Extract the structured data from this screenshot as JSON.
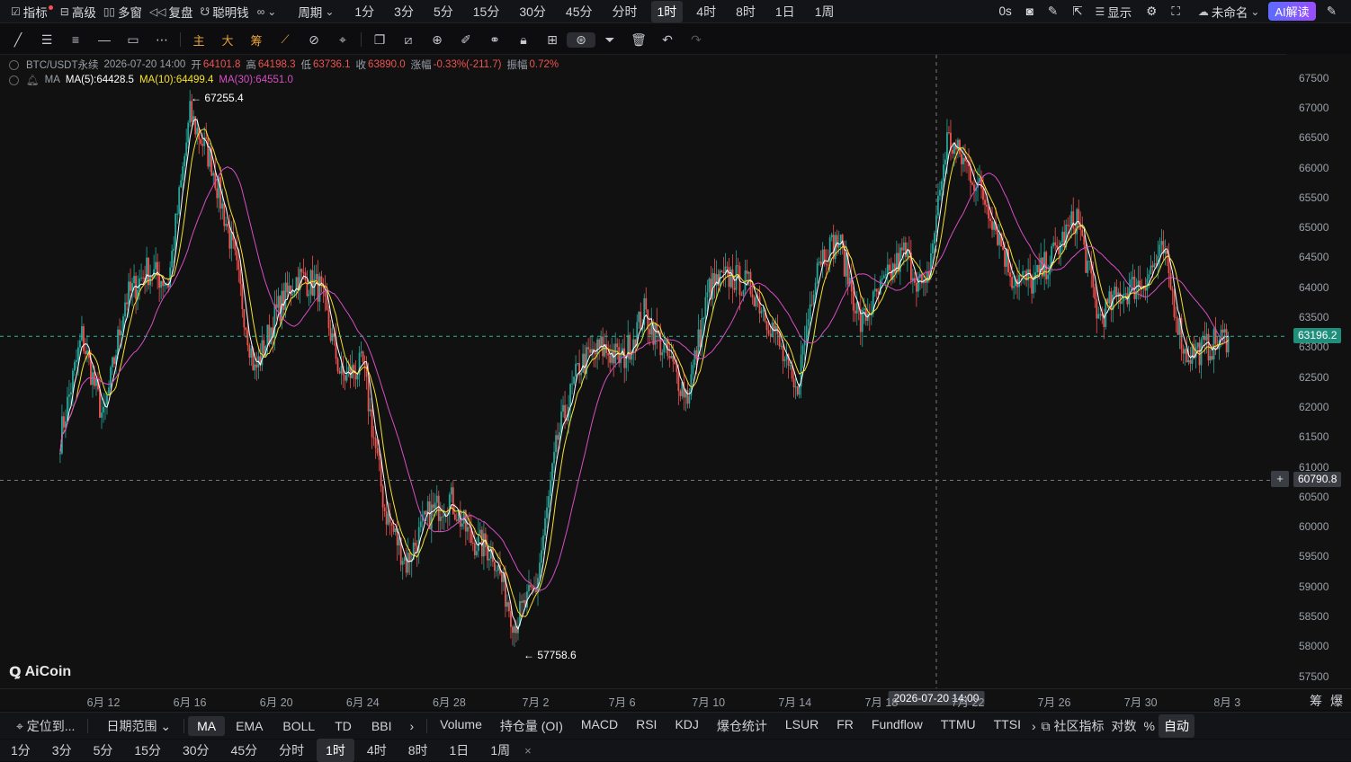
{
  "topbar": {
    "indicator": "指标",
    "advanced": "高级",
    "multi_window": "多窗",
    "replay": "复盘",
    "smart_money": "聪明钱",
    "period_label": "周期",
    "periods": [
      "1分",
      "3分",
      "5分",
      "15分",
      "30分",
      "45分",
      "分时",
      "1时",
      "4时",
      "8时",
      "1日",
      "1周"
    ],
    "active_period": "1时",
    "latency": "0s",
    "display": "显示",
    "unnamed": "未命名",
    "ai_button": "AI解读"
  },
  "toolbar": {
    "main": "主",
    "big": "大",
    "chips": "筹"
  },
  "legend": {
    "symbol": "BTC/USDT永续",
    "datetime": "2026-07-20 14:00",
    "open_label": "开",
    "open": "64101.8",
    "high_label": "高",
    "high": "64198.3",
    "low_label": "低",
    "low": "63736.1",
    "close_label": "收",
    "close": "63890.0",
    "change_label": "涨幅",
    "change": "-0.33%(-211.7)",
    "amplitude_label": "振幅",
    "amplitude": "0.72%",
    "ma_label": "MA",
    "ma5": "MA(5):64428.5",
    "ma10": "MA(10):64499.4",
    "ma30": "MA(30):64551.0"
  },
  "chart_data": {
    "type": "candlestick",
    "symbol": "BTC/USDT永续",
    "interval": "1时",
    "x_ticks": [
      "6月 12",
      "6月 16",
      "6月 20",
      "6月 24",
      "6月 28",
      "7月 2",
      "7月 6",
      "7月 10",
      "7月 14",
      "7月 18",
      "7月 22",
      "7月 26",
      "7月 30",
      "8月 3"
    ],
    "y_ticks": [
      67500,
      67000,
      66500,
      66000,
      65500,
      65000,
      64500,
      64000,
      63500,
      63000,
      62500,
      62000,
      61500,
      61000,
      60500,
      60000,
      59500,
      59000,
      58500,
      58000,
      57500
    ],
    "ylim": [
      57300,
      67900
    ],
    "close_series_daily": [
      {
        "x": "6月 10",
        "y": 61500
      },
      {
        "x": "6月 11",
        "y": 63200
      },
      {
        "x": "6月 12",
        "y": 61800
      },
      {
        "x": "6月 13",
        "y": 63800
      },
      {
        "x": "6月 14",
        "y": 64300
      },
      {
        "x": "6月 15",
        "y": 64100
      },
      {
        "x": "6月 16",
        "y": 66900
      },
      {
        "x": "6月 17",
        "y": 66100
      },
      {
        "x": "6月 18",
        "y": 64600
      },
      {
        "x": "6月 19",
        "y": 62600
      },
      {
        "x": "6月 20",
        "y": 63600
      },
      {
        "x": "6月 21",
        "y": 64200
      },
      {
        "x": "6月 22",
        "y": 64000
      },
      {
        "x": "6月 23",
        "y": 62500
      },
      {
        "x": "6月 24",
        "y": 62700
      },
      {
        "x": "6月 25",
        "y": 60300
      },
      {
        "x": "6月 26",
        "y": 59400
      },
      {
        "x": "6月 27",
        "y": 60200
      },
      {
        "x": "6月 28",
        "y": 60500
      },
      {
        "x": "6月 29",
        "y": 59800
      },
      {
        "x": "6月 30",
        "y": 59600
      },
      {
        "x": "7月 1",
        "y": 58400
      },
      {
        "x": "7月 2",
        "y": 59000
      },
      {
        "x": "7月 3",
        "y": 61500
      },
      {
        "x": "7月 4",
        "y": 62700
      },
      {
        "x": "7月 5",
        "y": 63000
      },
      {
        "x": "7月 6",
        "y": 62800
      },
      {
        "x": "7月 7",
        "y": 63600
      },
      {
        "x": "7月 8",
        "y": 62900
      },
      {
        "x": "7月 9",
        "y": 62200
      },
      {
        "x": "7月 10",
        "y": 64000
      },
      {
        "x": "7月 11",
        "y": 64200
      },
      {
        "x": "7月 12",
        "y": 64000
      },
      {
        "x": "7月 13",
        "y": 63300
      },
      {
        "x": "7月 14",
        "y": 62200
      },
      {
        "x": "7月 15",
        "y": 64500
      },
      {
        "x": "7月 16",
        "y": 64800
      },
      {
        "x": "7月 17",
        "y": 63400
      },
      {
        "x": "7月 18",
        "y": 64000
      },
      {
        "x": "7月 19",
        "y": 64600
      },
      {
        "x": "7月 20",
        "y": 63900
      },
      {
        "x": "7月 21",
        "y": 66500
      },
      {
        "x": "7月 22",
        "y": 66000
      },
      {
        "x": "7月 23",
        "y": 65300
      },
      {
        "x": "7月 24",
        "y": 64200
      },
      {
        "x": "7月 25",
        "y": 64100
      },
      {
        "x": "7月 26",
        "y": 64600
      },
      {
        "x": "7月 27",
        "y": 65200
      },
      {
        "x": "7月 28",
        "y": 63500
      },
      {
        "x": "7月 29",
        "y": 63900
      },
      {
        "x": "7月 30",
        "y": 64100
      },
      {
        "x": "7月 31",
        "y": 64600
      },
      {
        "x": "8月 1",
        "y": 62900
      },
      {
        "x": "8月 2",
        "y": 63000
      },
      {
        "x": "8月 3",
        "y": 63200
      }
    ],
    "max_marker": {
      "label": "← 67255.4",
      "value": 67255.4,
      "x": "6月 16"
    },
    "min_marker": {
      "label": "← 57758.6",
      "value": 57758.6,
      "x": "7月 2"
    },
    "crosshair_time": "2026-07-20 14:00",
    "current_price": "63196.2",
    "crosshair_price": "60790.8",
    "ma_colors": {
      "ma5": "#ffffff",
      "ma10": "#f5e12d",
      "ma30": "#d64fc4"
    },
    "up_color": "#26a69a",
    "down_color": "#ef5350"
  },
  "bottombar": {
    "locate": "定位到...",
    "date_range": "日期范围",
    "overlays": [
      "MA",
      "EMA",
      "BOLL",
      "TD",
      "BBI"
    ],
    "active_overlay": "MA",
    "sub_indicators": [
      "Volume",
      "持仓量 (OI)",
      "MACD",
      "RSI",
      "KDJ",
      "爆仓统计",
      "LSUR",
      "FR",
      "Fundflow",
      "TTMU",
      "TTSI"
    ],
    "community": "社区指标",
    "log_scale": "对数",
    "percent": "%",
    "auto": "自动",
    "periods": [
      "1分",
      "3分",
      "5分",
      "15分",
      "30分",
      "45分",
      "分时",
      "1时",
      "4时",
      "8时",
      "1日",
      "1周"
    ],
    "active_period": "1时",
    "close_x": "×"
  },
  "axis_corner": {
    "chips": "筹",
    "boom": "爆"
  },
  "brand": "AiCoin"
}
